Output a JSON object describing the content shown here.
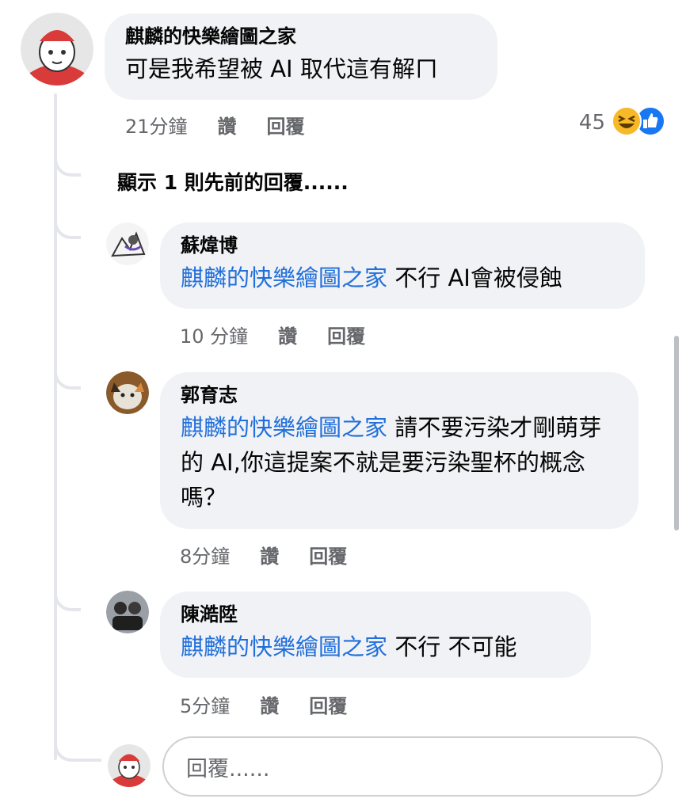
{
  "main_comment": {
    "author": "麒麟的快樂繪圖之家",
    "text": "可是我希望被 AI 取代這有解ㄇ",
    "time": "21分鐘",
    "like_label": "讚",
    "reply_label": "回覆",
    "reaction_count": "45",
    "reaction_icons": [
      "laugh-emoji-icon",
      "like-thumb-icon"
    ]
  },
  "show_previous": "顯示 1 則先前的回覆......",
  "replies": [
    {
      "author": "蘇煒博",
      "mention": "麒麟的快樂繪圖之家",
      "text": " 不行 AI會被侵蝕",
      "time": "10 分鐘",
      "like_label": "讚",
      "reply_label": "回覆"
    },
    {
      "author": "郭育志",
      "mention": "麒麟的快樂繪圖之家",
      "text": " 請不要污染才剛萌芽的 AI,你這提案不就是要污染聖杯的概念嗎？",
      "time": "8分鐘",
      "like_label": "讚",
      "reply_label": "回覆"
    },
    {
      "author": "陳澔陞",
      "mention": "麒麟的快樂繪圖之家",
      "text": " 不行 不可能",
      "time": "5分鐘",
      "like_label": "讚",
      "reply_label": "回覆"
    }
  ],
  "reply_box": {
    "placeholder": "回覆......"
  },
  "colors": {
    "mention": "#216fdb",
    "bubble": "#f0f2f5",
    "meta": "#65676b",
    "like_blue": "#1877f2",
    "laugh_yellow": "#f7b928"
  }
}
